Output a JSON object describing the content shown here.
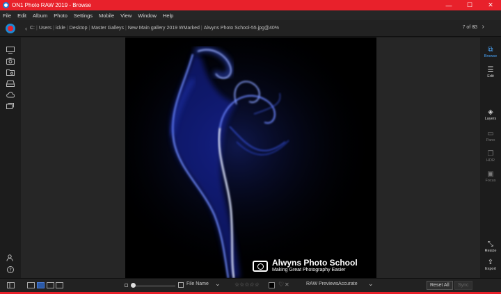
{
  "window": {
    "title": "ON1 Photo RAW 2019 - Browse",
    "controls": [
      "—",
      "☐",
      "✕"
    ]
  },
  "menu": [
    "File",
    "Edit",
    "Album",
    "Photo",
    "Settings",
    "Mobile",
    "View",
    "Window",
    "Help"
  ],
  "path": {
    "crumbs": [
      "C:",
      "Users",
      "ickle",
      "Desktop",
      "Master Galleys",
      "New Main gallery 2019 WMarked",
      "Alwyns Photo School-55.jpg@40%"
    ],
    "counter": "7 of 63"
  },
  "left_sidebar": {
    "icons": [
      "monitor-icon",
      "camera-icon",
      "folder-search-icon",
      "drive-icon",
      "cloud-icon",
      "albums-icon",
      "user-settings-icon",
      "help-icon"
    ]
  },
  "right_sidebar": {
    "tools": [
      {
        "label": "Browse",
        "icon": "browse-icon",
        "state": "active"
      },
      {
        "label": "Edit",
        "icon": "edit-sliders-icon",
        "state": "normal"
      },
      {
        "label": "Layers",
        "icon": "layers-icon",
        "state": "normal"
      },
      {
        "label": "Pano",
        "icon": "pano-icon",
        "state": "dim"
      },
      {
        "label": "HDR",
        "icon": "hdr-icon",
        "state": "dim"
      },
      {
        "label": "Focus",
        "icon": "focus-icon",
        "state": "dim"
      },
      {
        "label": "Resize",
        "icon": "resize-icon",
        "state": "normal"
      },
      {
        "label": "Export",
        "icon": "export-icon",
        "state": "normal"
      }
    ]
  },
  "watermark": {
    "title": "Alwyns Photo School",
    "subtitle": "Making Great Photography Easier"
  },
  "bottom": {
    "sort_label": "File Name",
    "raw_previews_label": "RAW Previews",
    "raw_previews_value": "Accurate",
    "reset_all": "Reset All",
    "sync": "Sync",
    "stars": "☆☆☆☆☆",
    "heart": "♡",
    "reject": "✕"
  },
  "colors": {
    "titlebar": "#e8212b",
    "accent": "#4aa8ff",
    "smoke": "#2d4dff"
  }
}
